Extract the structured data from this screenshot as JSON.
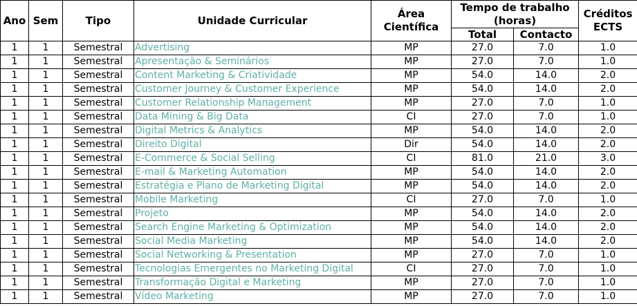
{
  "headers": {
    "ano": "Ano",
    "sem": "Sem",
    "tipo": "Tipo",
    "uc": "Unidade Curricular",
    "area": "Área Científica",
    "tempo": "Tempo de trabalho (horas)",
    "total": "Total",
    "contacto": "Contacto",
    "ects": "Créditos ECTS"
  },
  "rows": [
    {
      "ano": "1",
      "sem": "1",
      "tipo": "Semestral",
      "uc": "Advertising",
      "area": "MP",
      "total": "27.0",
      "contacto": "7.0",
      "ects": "1.0"
    },
    {
      "ano": "1",
      "sem": "1",
      "tipo": "Semestral",
      "uc": "Apresentação & Seminários",
      "area": "MP",
      "total": "27.0",
      "contacto": "7.0",
      "ects": "1.0"
    },
    {
      "ano": "1",
      "sem": "1",
      "tipo": "Semestral",
      "uc": "Content Marketing & Criatividade",
      "area": "MP",
      "total": "54.0",
      "contacto": "14.0",
      "ects": "2.0"
    },
    {
      "ano": "1",
      "sem": "1",
      "tipo": "Semestral",
      "uc": "Customer Journey & Customer Experience",
      "area": "MP",
      "total": "54.0",
      "contacto": "14.0",
      "ects": "2.0"
    },
    {
      "ano": "1",
      "sem": "1",
      "tipo": "Semestral",
      "uc": "Customer Relationship Management",
      "area": "MP",
      "total": "27.0",
      "contacto": "7.0",
      "ects": "1.0"
    },
    {
      "ano": "1",
      "sem": "1",
      "tipo": "Semestral",
      "uc": "Data Mining & Big Data",
      "area": "CI",
      "total": "27.0",
      "contacto": "7.0",
      "ects": "1.0"
    },
    {
      "ano": "1",
      "sem": "1",
      "tipo": "Semestral",
      "uc": "Digital Metrics & Analytics",
      "area": "MP",
      "total": "54.0",
      "contacto": "14.0",
      "ects": "2.0"
    },
    {
      "ano": "1",
      "sem": "1",
      "tipo": "Semestral",
      "uc": "Direito Digital",
      "area": "Dir",
      "total": "54.0",
      "contacto": "14.0",
      "ects": "2.0"
    },
    {
      "ano": "1",
      "sem": "1",
      "tipo": "Semestral",
      "uc": "E-Commerce & Social Selling",
      "area": "CI",
      "total": "81.0",
      "contacto": "21.0",
      "ects": "3.0"
    },
    {
      "ano": "1",
      "sem": "1",
      "tipo": "Semestral",
      "uc": "E-mail & Marketing Automation",
      "area": "MP",
      "total": "54.0",
      "contacto": "14.0",
      "ects": "2.0"
    },
    {
      "ano": "1",
      "sem": "1",
      "tipo": "Semestral",
      "uc": "Estratégia e Plano de Marketing Digital",
      "area": "MP",
      "total": "54.0",
      "contacto": "14.0",
      "ects": "2.0"
    },
    {
      "ano": "1",
      "sem": "1",
      "tipo": "Semestral",
      "uc": "Mobile Marketing",
      "area": "CI",
      "total": "27.0",
      "contacto": "7.0",
      "ects": "1.0"
    },
    {
      "ano": "1",
      "sem": "1",
      "tipo": "Semestral",
      "uc": "Projeto",
      "area": "MP",
      "total": "54.0",
      "contacto": "14.0",
      "ects": "2.0"
    },
    {
      "ano": "1",
      "sem": "1",
      "tipo": "Semestral",
      "uc": "Search Engine Marketing & Optimization",
      "area": "MP",
      "total": "54.0",
      "contacto": "14.0",
      "ects": "2.0"
    },
    {
      "ano": "1",
      "sem": "1",
      "tipo": "Semestral",
      "uc": "Social Media Marketing",
      "area": "MP",
      "total": "54.0",
      "contacto": "14.0",
      "ects": "2.0"
    },
    {
      "ano": "1",
      "sem": "1",
      "tipo": "Semestral",
      "uc": "Social Networking & Presentation",
      "area": "MP",
      "total": "27.0",
      "contacto": "7.0",
      "ects": "1.0"
    },
    {
      "ano": "1",
      "sem": "1",
      "tipo": "Semestral",
      "uc": "Tecnologias Emergentes no Marketing Digital",
      "area": "CI",
      "total": "27.0",
      "contacto": "7.0",
      "ects": "1.0"
    },
    {
      "ano": "1",
      "sem": "1",
      "tipo": "Semestral",
      "uc": "Transformação Digital e Marketing",
      "area": "MP",
      "total": "27.0",
      "contacto": "7.0",
      "ects": "1.0"
    },
    {
      "ano": "1",
      "sem": "1",
      "tipo": "Semestral",
      "uc": "Vídeo Marketing",
      "area": "MP",
      "total": "27.0",
      "contacto": "7.0",
      "ects": "1.0"
    }
  ],
  "colors": {
    "link": "#5fb0a5",
    "border": "#000000"
  }
}
